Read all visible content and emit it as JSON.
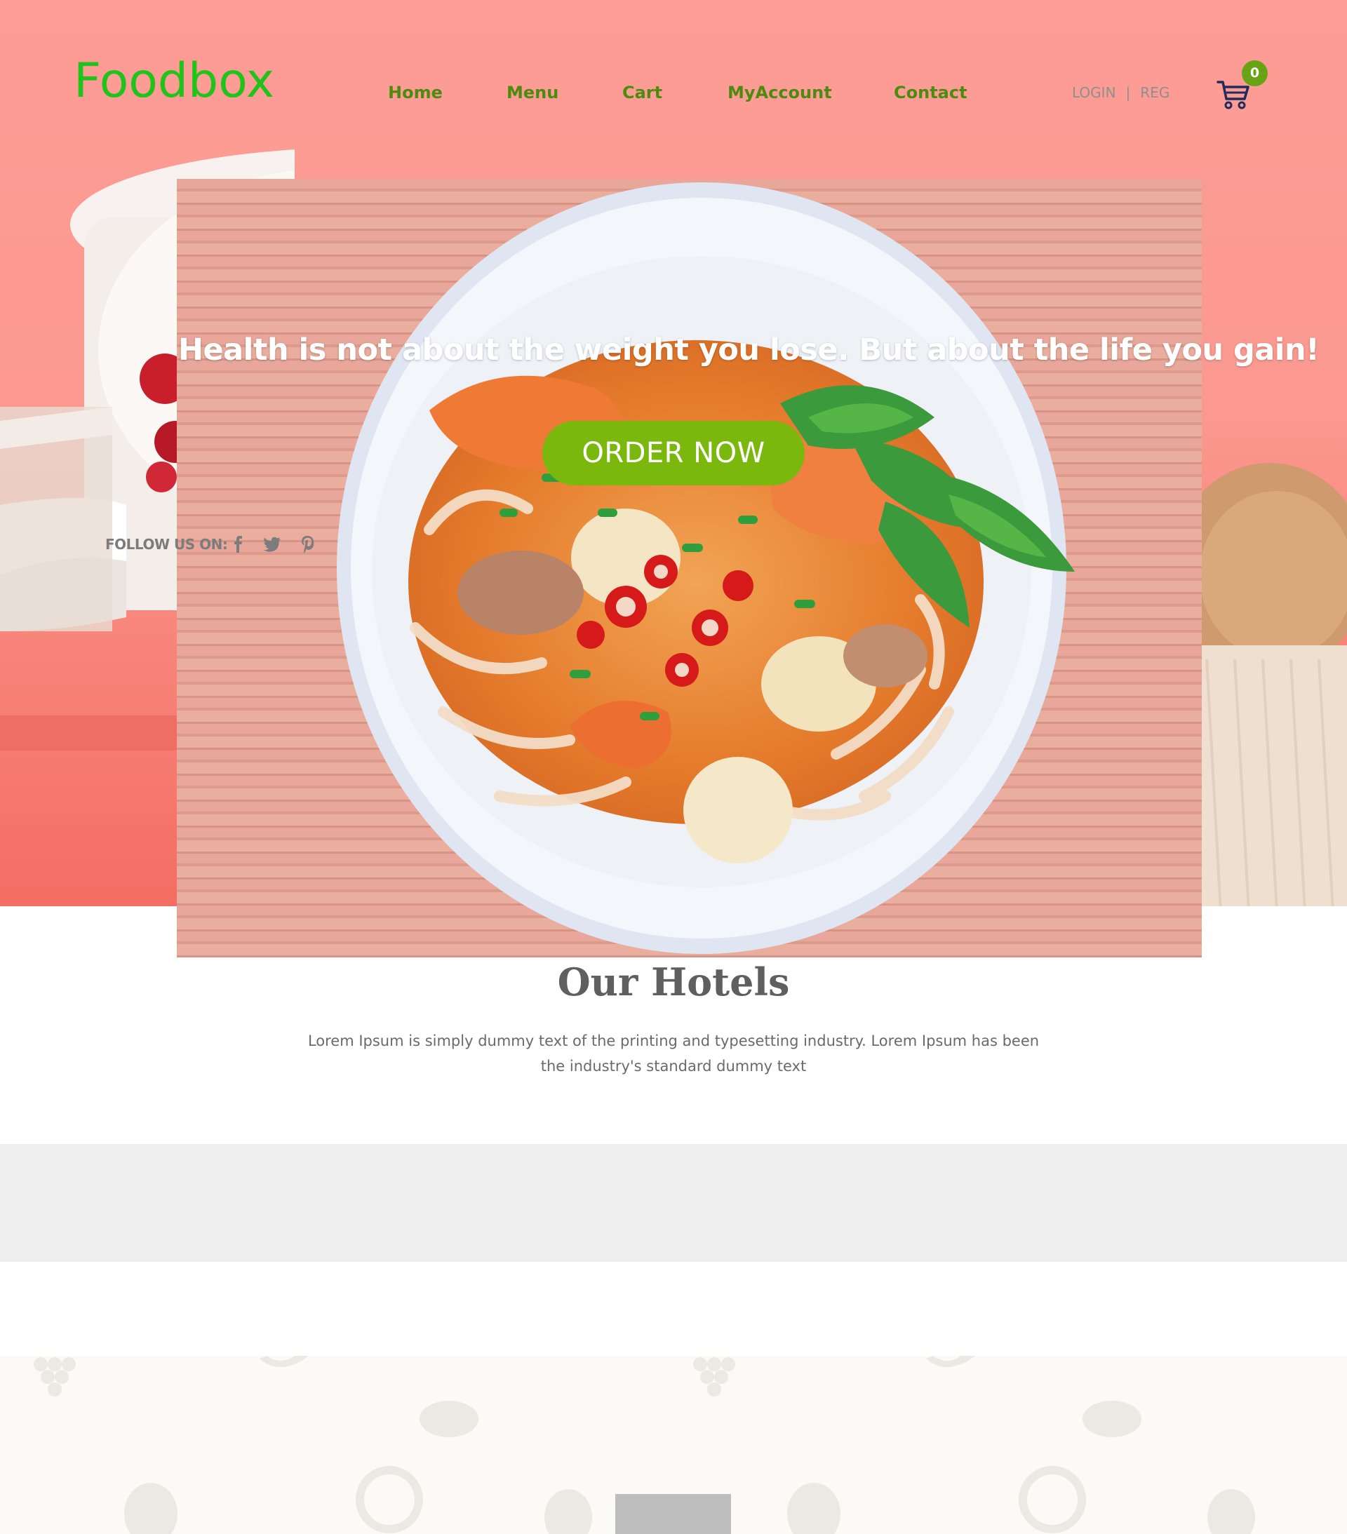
{
  "brand": {
    "logo_text": "Foodbox"
  },
  "nav": {
    "items": [
      {
        "label": "Home"
      },
      {
        "label": "Menu"
      },
      {
        "label": "Cart"
      },
      {
        "label": "MyAccount"
      },
      {
        "label": "Contact"
      }
    ]
  },
  "auth": {
    "login_label": "LOGIN",
    "separator": "|",
    "register_label": "REG"
  },
  "cart": {
    "count": "0",
    "icon": "shopping-cart-icon"
  },
  "hero": {
    "headline": "Health is not about the weight you lose. But about the life you gain!",
    "cta_label": "ORDER NOW",
    "follow_label": "FOLLOW US ON:",
    "social_icons": [
      "facebook-icon",
      "twitter-icon",
      "pinterest-icon"
    ]
  },
  "hotels": {
    "title": "Our Hotels",
    "description": "Lorem Ipsum is simply dummy text of the printing and typesetting industry. Lorem Ipsum has been the industry's standard dummy text"
  },
  "colors": {
    "logo_green": "#1fc31b",
    "nav_green": "#4d8b10",
    "button_green": "#7bb80e",
    "badge_green": "#68a313",
    "hero_pink": "#fb9990",
    "band_gray": "#eeeeee"
  }
}
